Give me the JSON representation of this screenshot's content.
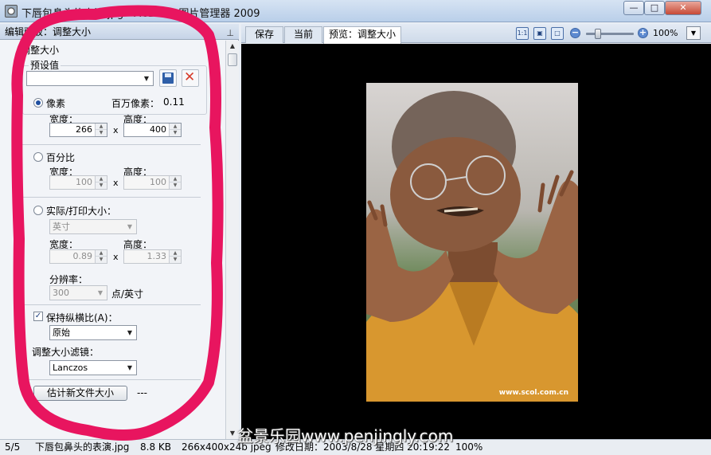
{
  "window": {
    "title": "下唇包鼻头的表演.jpg - ACDSee 图片管理器 2009",
    "min_label": "—",
    "max_label": "□",
    "close_label": "✕"
  },
  "panel": {
    "header": "编辑面板：调整大小",
    "section_title": "调整大小",
    "preset_label": "预设值",
    "preset_value": "",
    "pixels": {
      "label": "像素",
      "megapixel_label": "百万像素：",
      "megapixel_value": "0.11",
      "width_label": "宽度：",
      "height_label": "高度：",
      "width_value": "266",
      "height_value": "400",
      "times": "x"
    },
    "percent": {
      "label": "百分比",
      "width_label": "宽度：",
      "height_label": "高度：",
      "width_value": "100",
      "height_value": "100",
      "times": "x"
    },
    "print": {
      "label": "实际/打印大小：",
      "unit_value": "英寸",
      "width_label": "宽度：",
      "height_label": "高度：",
      "width_value": "0.89",
      "height_value": "1.33",
      "times": "x",
      "resolution_label": "分辨率：",
      "resolution_value": "300",
      "resolution_unit": "点/英寸"
    },
    "aspect": {
      "label": "保持纵横比(A)：",
      "checked": true,
      "value": "原始"
    },
    "filter": {
      "label": "调整大小滤镜：",
      "value": "Lanczos"
    },
    "estimate_button": "估计新文件大小",
    "estimate_result": "---"
  },
  "toolbar": {
    "tabs": [
      "保存",
      "当前",
      "预览：调整大小"
    ],
    "zoom": "100%"
  },
  "status": {
    "index": "5/5",
    "filename": "下唇包鼻头的表演.jpg",
    "size": "8.8 KB",
    "dimensions": "266x400x24b jpeg",
    "modified": "修改日期：2003/8/28 星期四 20:19:22",
    "zoom": "100%"
  },
  "watermark": "盆景乐园www.penjingly.com",
  "photo_caption": "www.scol.com.cn",
  "colors": {
    "annotation": "#e8155f",
    "accent": "#1f4fa0"
  }
}
